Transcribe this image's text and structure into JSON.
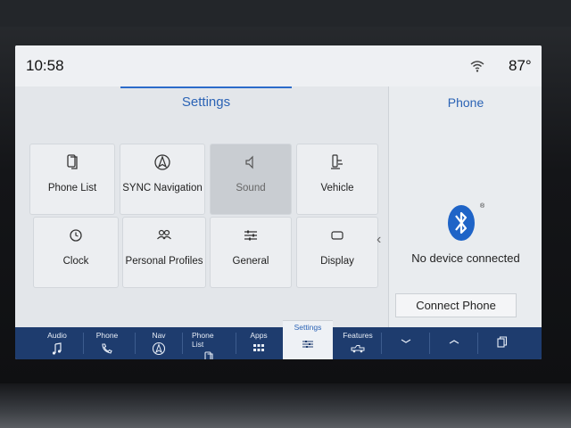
{
  "status": {
    "time": "10:58",
    "temperature": "87°"
  },
  "settings": {
    "title": "Settings",
    "tiles": [
      {
        "label": "Phone List",
        "icon": "phone-list-icon"
      },
      {
        "label": "SYNC Navigation",
        "icon": "navigation-icon"
      },
      {
        "label": "Sound",
        "icon": "speaker-icon",
        "disabled": true
      },
      {
        "label": "Vehicle",
        "icon": "vehicle-icon"
      },
      {
        "label": "Clock",
        "icon": "clock-icon"
      },
      {
        "label": "Personal Profiles",
        "icon": "profiles-icon"
      },
      {
        "label": "General",
        "icon": "sliders-icon"
      },
      {
        "label": "Display",
        "icon": "display-icon"
      }
    ],
    "page_indicator": {
      "current": 1,
      "total": 2
    }
  },
  "phone": {
    "title": "Phone",
    "status": "No device connected",
    "connect_label": "Connect Phone"
  },
  "navbar": {
    "items": [
      {
        "label": "Audio",
        "icon": "music-note-icon"
      },
      {
        "label": "Phone",
        "icon": "phone-icon"
      },
      {
        "label": "Nav",
        "icon": "navigation-icon"
      },
      {
        "label": "Phone List",
        "icon": "phone-list-icon"
      },
      {
        "label": "Apps",
        "icon": "apps-grid-icon"
      },
      {
        "label": "Settings",
        "icon": "sliders-icon",
        "active": true
      },
      {
        "label": "Features",
        "icon": "truck-icon"
      }
    ],
    "right_buttons": [
      "chevron-down-icon",
      "chevron-up-icon",
      "windows-icon"
    ]
  },
  "colors": {
    "accent": "#2b63b5",
    "navbar": "#1e3c6e",
    "screen_bg": "#dfe3e8"
  }
}
